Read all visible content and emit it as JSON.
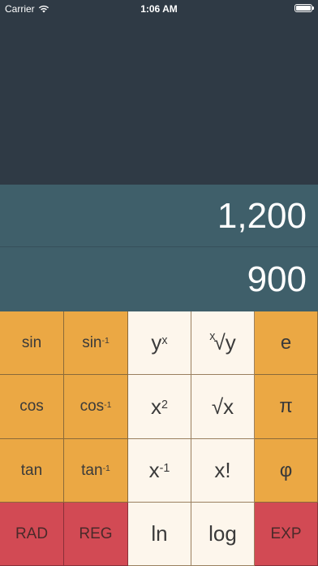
{
  "status_bar": {
    "carrier": "Carrier",
    "time": "1:06 AM",
    "wifi_icon": "wifi-icon",
    "battery_icon": "battery-icon"
  },
  "display": {
    "previous_value": "1,200",
    "current_value": "900"
  },
  "keypad": {
    "sin": "sin",
    "asin_base": "sin",
    "asin_exp": "-1",
    "y_pow_x_base": "y",
    "y_pow_x_exp": "x",
    "xth_root_index": "x",
    "xth_root_sym": "√y",
    "e": "e",
    "cos": "cos",
    "acos_base": "cos",
    "acos_exp": "-1",
    "x_sq_base": "x",
    "x_sq_exp": "2",
    "sqrt": "√x",
    "pi": "π",
    "tan": "tan",
    "atan_base": "tan",
    "atan_exp": "-1",
    "x_inv_base": "x",
    "x_inv_exp": "-1",
    "factorial": "x!",
    "phi": "φ",
    "rad": "RAD",
    "reg": "REG",
    "ln": "ln",
    "log": "log",
    "exp": "EXP"
  },
  "colors": {
    "background": "#2f3a45",
    "display": "#3f5f6a",
    "orange_key": "#eba844",
    "cream_key": "#fdf6ec",
    "red_key": "#d24a54"
  }
}
